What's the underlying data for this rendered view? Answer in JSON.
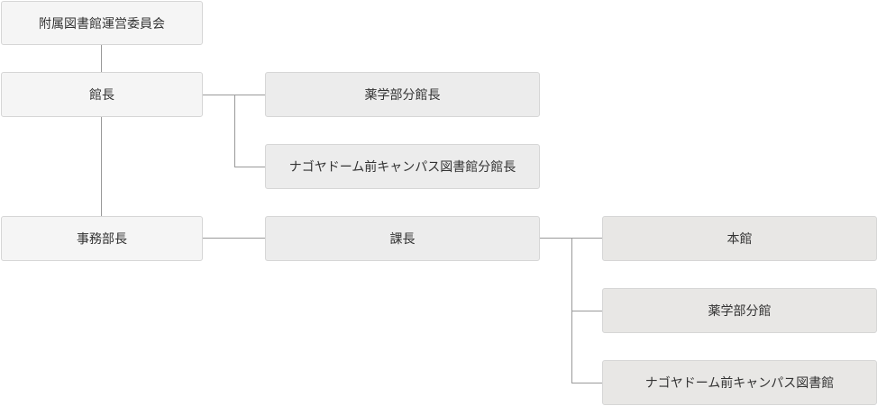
{
  "chart": {
    "committee": "附属図書館運営委員会",
    "director": "館長",
    "pharmacy_branch_director": "薬学部分館長",
    "nagoya_dome_branch_director": "ナゴヤドーム前キャンパス図書館分館長",
    "admin_director": "事務部長",
    "section_chief": "課長",
    "main_library": "本館",
    "pharmacy_branch": "薬学部分館",
    "nagoya_dome_library": "ナゴヤドーム前キャンパス図書館"
  }
}
